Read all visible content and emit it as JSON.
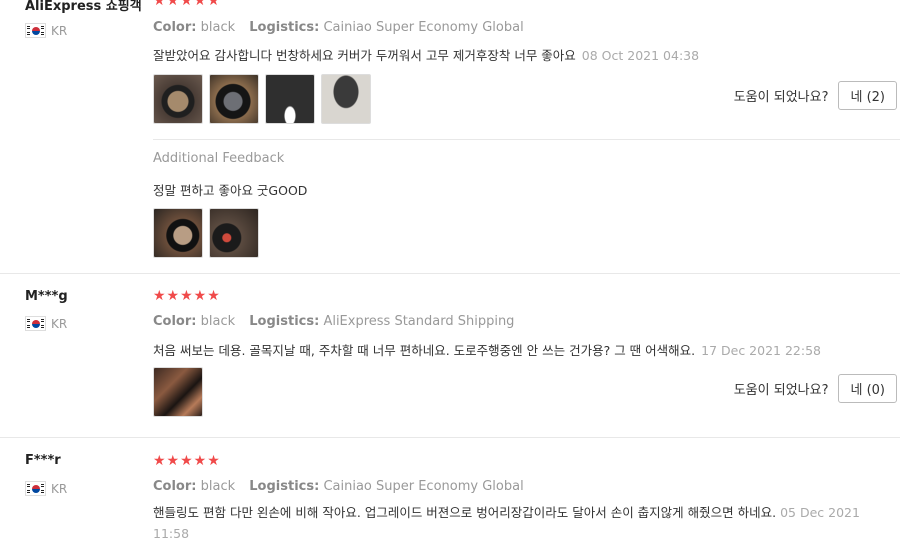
{
  "labels": {
    "color": "Color:",
    "logistics": "Logistics:",
    "helpful": "도움이 되었나요?",
    "additional_feedback": "Additional Feedback"
  },
  "colors": {
    "star": "#f04a4a",
    "meta_gray": "#999999"
  },
  "reviews": [
    {
      "reviewer": "AliExpress 쇼핑객",
      "country": "KR",
      "rating": 5,
      "color": "black",
      "logistics": "Cainiao Super Economy Global",
      "text": "잘받았어요 감사합니다 번창하세요 커버가 두꺼워서 고무 제거후장착 너무 좋아요",
      "date": "08 Oct 2021 04:38",
      "photos": 4,
      "helpful_button": "네 (2)",
      "additional_feedback": {
        "text": "정말 편하고 좋아요 굿GOOD",
        "photos": 2
      }
    },
    {
      "reviewer": "M***g",
      "country": "KR",
      "rating": 5,
      "color": "black",
      "logistics": "AliExpress Standard Shipping",
      "text": "처음 써보는 데용. 골목지날 때, 주차할 때 너무 편하네요. 도로주행중엔 안 쓰는 건가용? 그 땐 어색해요.",
      "date": "17 Dec 2021 22:58",
      "photos": 1,
      "helpful_button": "네 (0)"
    },
    {
      "reviewer": "F***r",
      "country": "KR",
      "rating": 5,
      "color": "black",
      "logistics": "Cainiao Super Economy Global",
      "text": "핸들링도 편함 다만 왼손에 비해 작아요. 업그레이드 버젼으로 벙어리장갑이라도 달아서 손이 춥지않게 해줬으면 하네요.",
      "date": "05 Dec 2021 11:58"
    }
  ]
}
